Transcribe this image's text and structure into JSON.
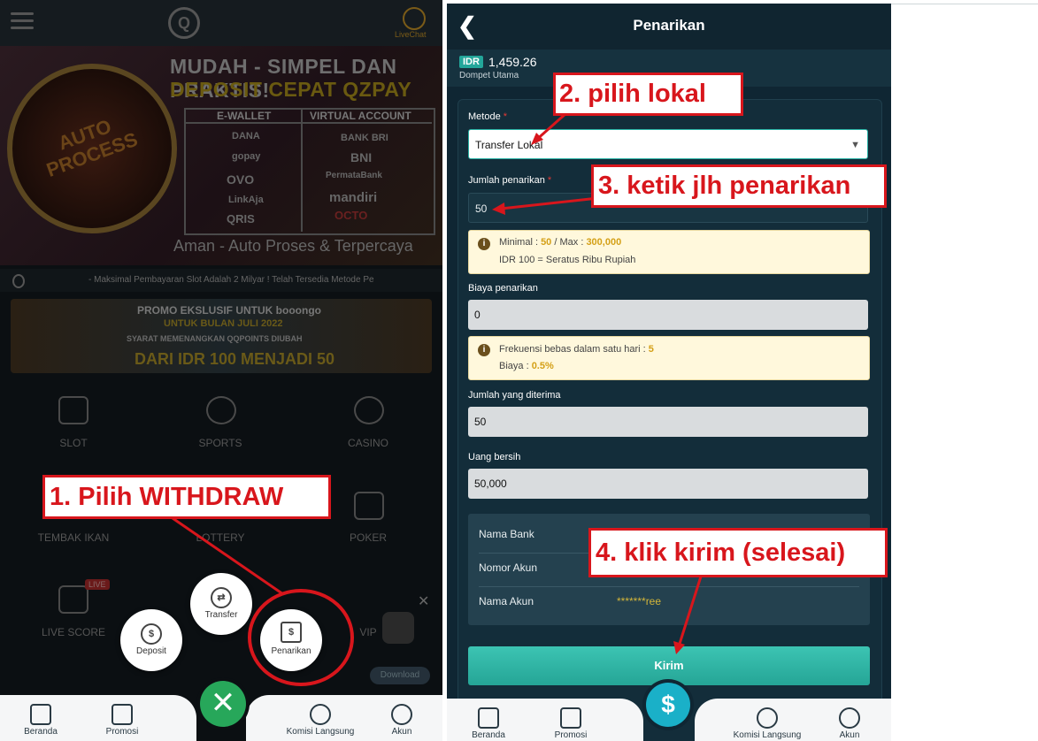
{
  "left": {
    "logo": "Q",
    "livechat_label": "LiveChat",
    "banner": {
      "title1": "MUDAH - SIMPEL DAN PRAKTIS!",
      "title2": "DEPOSIT CEPAT QZPAY",
      "seal_text": "AUTO PROCESS",
      "ewallet_header": "E-WALLET",
      "va_header": "VIRTUAL ACCOUNT",
      "ewallets": [
        "DANA",
        "gopay",
        "OVO",
        "LinkAja",
        "QRIS"
      ],
      "banks": [
        "BANK BRI",
        "BNI",
        "PermataBank",
        "mandiri",
        "OCTO"
      ],
      "footer": "Aman - Auto Proses & Terpercaya"
    },
    "ticker": "- Maksimal Pembayaran Slot Adalah 2 Milyar !      Telah Tersedia Metode Pe",
    "promo": {
      "line1": "PROMO EKSLUSIF UNTUK  booongo",
      "line2": "UNTUK BULAN JULI 2022",
      "line3": "SYARAT MEMENANGKAN QQPOINTS DIUBAH",
      "line4": "DARI IDR 100 MENJADI 50"
    },
    "categories": [
      "SLOT",
      "SPORTS",
      "CASINO",
      "TEMBAK IKAN",
      "LOTTERY",
      "POKER",
      "LIVE SCORE",
      "VIP"
    ],
    "live_badge": "LIVE",
    "download_label": "Download",
    "actions": {
      "deposit": "Deposit",
      "transfer": "Transfer",
      "withdraw": "Penarikan"
    },
    "nav": [
      "Beranda",
      "Promosi",
      "Komisi Langsung",
      "Akun"
    ]
  },
  "right": {
    "title": "Penarikan",
    "currency_badge": "IDR",
    "balance": "1,459.26",
    "wallet_label": "Dompet Utama",
    "method": {
      "label": "Metode",
      "value": "Transfer Lokal"
    },
    "amount": {
      "label": "Jumlah penarikan",
      "value": "50"
    },
    "limits": {
      "min_text": "Minimal : ",
      "min_value": "50",
      "sep_text": " / Max : ",
      "max_value": "300,000",
      "rate_text": "IDR 100 = Seratus Ribu Rupiah"
    },
    "fee": {
      "label": "Biaya penarikan",
      "value": "0"
    },
    "frequency": {
      "text": "Frekuensi bebas dalam satu hari : ",
      "count": "5",
      "fee_text": "Biaya : ",
      "fee_value": "0.5%"
    },
    "received": {
      "label": "Jumlah yang diterima",
      "value": "50"
    },
    "net": {
      "label": "Uang bersih",
      "value": "50,000"
    },
    "account": {
      "bank_label": "Nama Bank",
      "number_label": "Nomor Akun",
      "name_label": "Nama Akun",
      "name_value": "*******ree"
    },
    "submit_label": "Kirim",
    "nav": [
      "Beranda",
      "Promosi",
      "Komisi Langsung",
      "Akun"
    ]
  },
  "annotations": {
    "step1": "1. Pilih WITHDRAW",
    "step2": "2. pilih lokal",
    "step3": "3. ketik jlh penarikan",
    "step4": "4. klik kirim (selesai)"
  },
  "colors": {
    "annotation_red": "#d8161c",
    "fab_green": "#27a75a",
    "teal_button": "#2fb5a5",
    "gold": "#d4a017"
  }
}
